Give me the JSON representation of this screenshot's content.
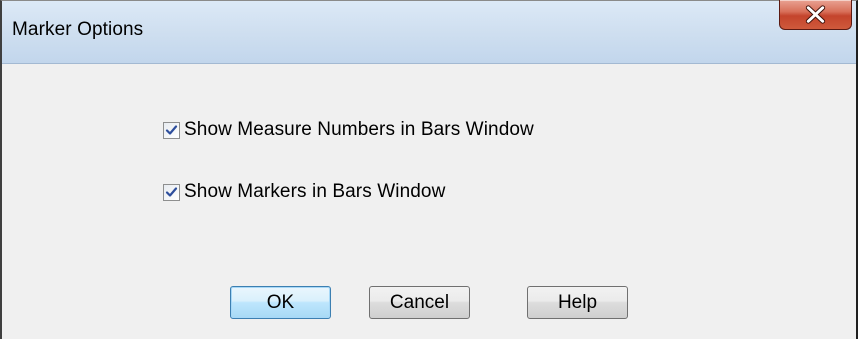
{
  "window": {
    "title": "Marker Options"
  },
  "titlebar": {
    "close_icon": "close-x-icon",
    "close_color": "#c4442c"
  },
  "options": [
    {
      "label": "Show Measure Numbers in Bars Window",
      "checked": true
    },
    {
      "label": "Show Markers in Bars Window",
      "checked": true
    }
  ],
  "buttons": {
    "ok": "OK",
    "cancel": "Cancel",
    "help": "Help"
  }
}
